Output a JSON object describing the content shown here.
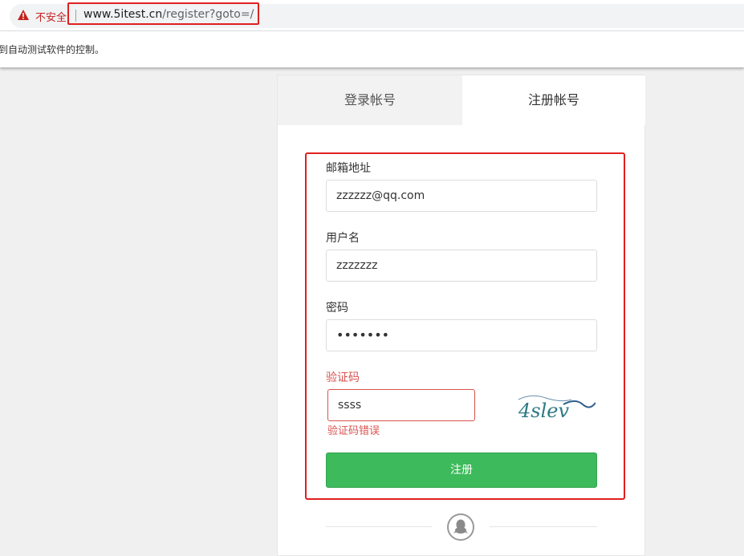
{
  "browser": {
    "security_label": "不安全",
    "url_host": "www.5itest.cn",
    "url_path": "/register?goto=/",
    "infobar_text": "到自动测试软件的控制。"
  },
  "tabs": [
    {
      "label": "登录帐号",
      "active": false
    },
    {
      "label": "注册帐号",
      "active": true
    }
  ],
  "form": {
    "email": {
      "label": "邮箱地址",
      "value": "zzzzzz@qq.com"
    },
    "username": {
      "label": "用户名",
      "value": "zzzzzzz"
    },
    "password": {
      "label": "密码",
      "value": "•••••••"
    },
    "captcha": {
      "label": "验证码",
      "value": "ssss",
      "error": "验证码错误",
      "image_text": "4slev"
    },
    "submit_label": "注册"
  },
  "colors": {
    "primary_button": "#3dba5b",
    "error": "#d9534f",
    "highlight": "#e02020"
  }
}
